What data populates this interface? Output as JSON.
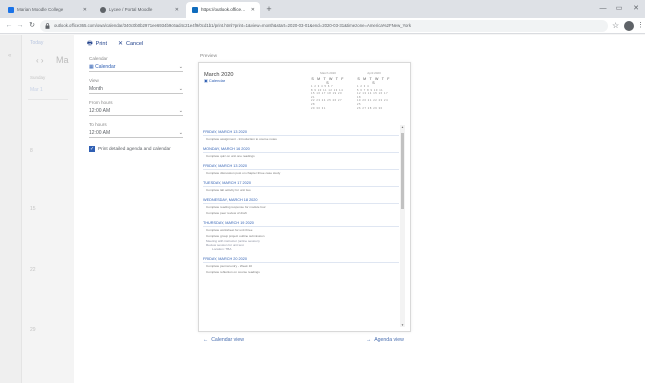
{
  "browser": {
    "tabs": [
      {
        "title": "Marian Moodle College",
        "favicon_color": "#1a73e8",
        "active": false
      },
      {
        "title": "Lycee / Portal Moodle",
        "favicon_color": "#5f6368",
        "active": false
      },
      {
        "title": "https://outlook.office365.com/calendar",
        "favicon_color": "#0f6cbd",
        "active": true
      }
    ],
    "url": "outlook.office365.com/owa/calendar/340c0b0b2971ee6934b9c6ad4c21e4f9/0cd1b1/print.html?print=1&view=month&start=2020-03-01&end=2020-03-31&timezone=America%2FNew_York"
  },
  "background": {
    "today_label": "Today",
    "month_label": "Ma",
    "weekday_label": "Sunday",
    "row_labels": [
      "Mar 1",
      "8",
      "15",
      "22",
      "29"
    ]
  },
  "toolbar": {
    "print_label": "Print",
    "cancel_label": "Cancel"
  },
  "options": {
    "calendar_label": "Calendar",
    "calendar_value": "Calendar",
    "view_label": "View",
    "view_value": "Month",
    "from_label": "From hours",
    "from_value": "12:00 AM",
    "to_label": "To hours",
    "to_value": "12:00 AM",
    "detail_checkbox_label": "Print detailed agenda and calendar",
    "detail_checked": true
  },
  "preview": {
    "label": "Preview",
    "page_title": "March 2020",
    "calendar_name": "Calendar",
    "mini_months": [
      {
        "title": "March 2020",
        "weekdays": "S M T W T F S",
        "rows": [
          "1 2 3 4 5 6 7",
          "8 9 10 11 12 13 14",
          "15 16 17 18 19 20 21",
          "22 23 24 25 26 27 28",
          "29 30 31"
        ]
      },
      {
        "title": "April 2020",
        "weekdays": "S M T W T F S",
        "rows": [
          "1 2 3 4",
          "5 6 7 8 9 10 11",
          "12 13 14 15 16 17 18",
          "19 20 21 22 23 24 25",
          "26 27 28 29 30"
        ]
      }
    ],
    "agenda": [
      {
        "day": "FRIDAY, MARCH 13 2020",
        "events": [
          "Complete assignment - Introduction to course notes"
        ],
        "sub": []
      },
      {
        "day": "MONDAY, MARCH 16 2020",
        "events": [
          "Complete quiz on unit one readings"
        ],
        "sub": []
      },
      {
        "day": "FRIDAY, MARCH 13 2020",
        "events": [
          "Complete discussion post on chapter three case study"
        ],
        "sub": []
      },
      {
        "day": "TUESDAY, MARCH 17 2020",
        "events": [
          "Complete lab activity for unit two"
        ],
        "sub": []
      },
      {
        "day": "WEDNESDAY, MARCH 18 2020",
        "events": [
          "Complete reading response for module four",
          "Complete peer review of draft"
        ],
        "sub": []
      },
      {
        "day": "THURSDAY, MARCH 19 2020",
        "events": [
          "Complete worksheet for unit three",
          "Complete group project outline submission"
        ],
        "sub": [
          "Meeting with instructor (online session)",
          "Review session for unit test",
          "Location: TBA"
        ]
      },
      {
        "day": "FRIDAY, MARCH 20 2020",
        "events": [
          "Complete journal entry - Week 10",
          "Complete reflection on course readings"
        ],
        "sub": []
      }
    ]
  },
  "footer": {
    "calendar_view": "Calendar view",
    "agenda_view": "Agenda view"
  }
}
